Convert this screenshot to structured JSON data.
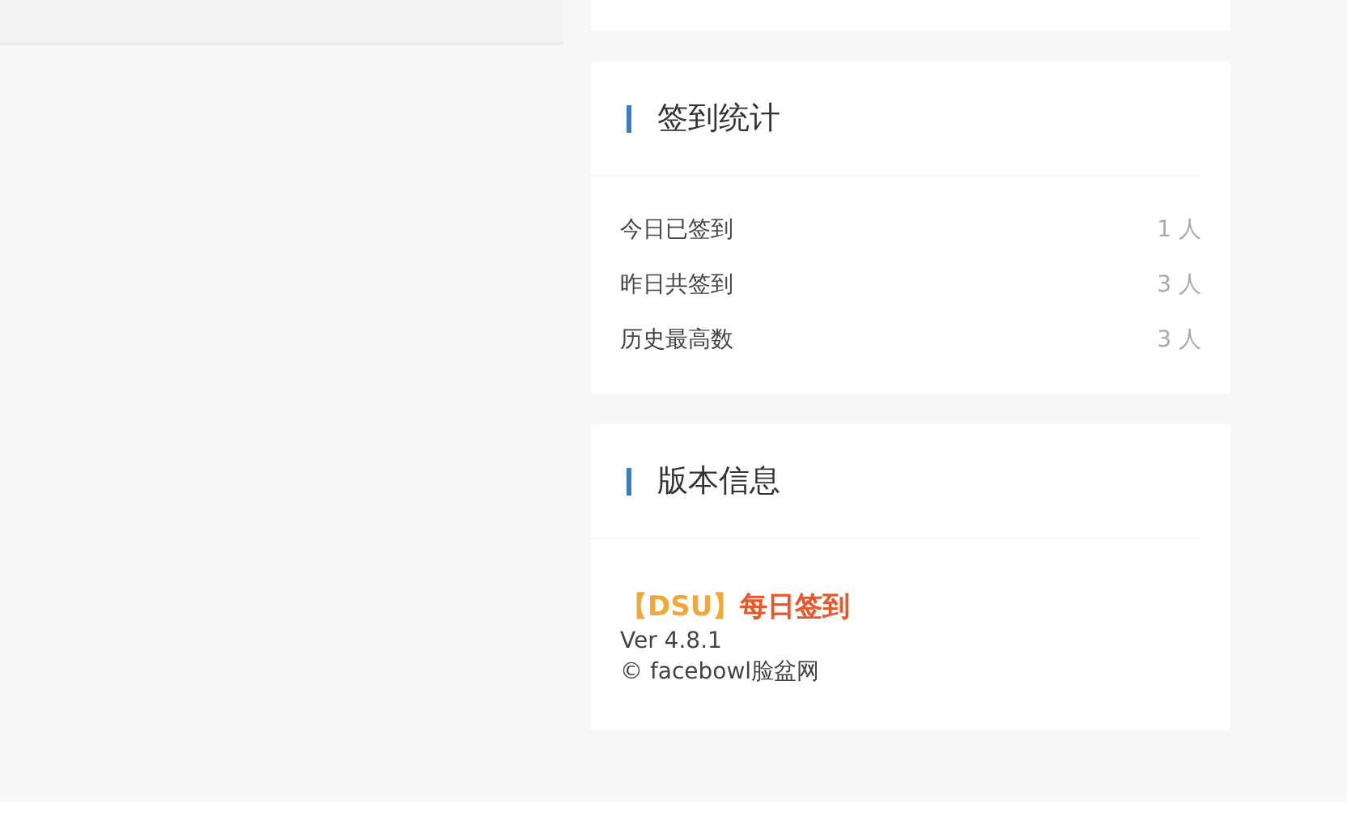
{
  "stats": {
    "title": "签到统计",
    "rows": [
      {
        "label": "今日已签到",
        "value": "1 人"
      },
      {
        "label": "昨日共签到",
        "value": "3 人"
      },
      {
        "label": "历史最高数",
        "value": "3 人"
      }
    ]
  },
  "version": {
    "title": "版本信息",
    "tag": "【DSU】",
    "name": "每日签到",
    "ver": "Ver 4.8.1",
    "copyright": "© facebowl脸盆网"
  }
}
